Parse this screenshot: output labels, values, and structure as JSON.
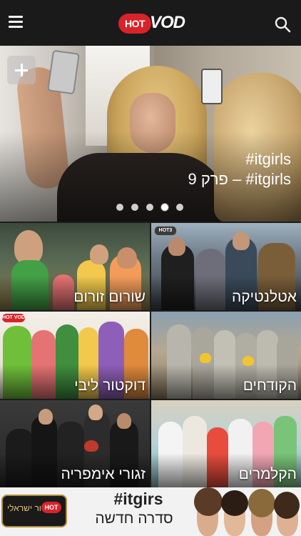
{
  "header": {
    "logo_hot": "HOT",
    "logo_vod": "VOD",
    "menu_icon": "hamburger-menu-icon",
    "search_icon": "search-icon"
  },
  "hero": {
    "line1": "itgirls#",
    "line2": "itgirls# – פרק 9",
    "add_icon": "plus-icon",
    "carousel": {
      "count": 5,
      "active_index": 3
    }
  },
  "tiles": [
    {
      "title": "שורום זורום",
      "badge": ""
    },
    {
      "title": "אטלנטיקה",
      "badge": "HOT3"
    },
    {
      "title": "דוקטור ליבי",
      "badge": "HOT VOD"
    },
    {
      "title": "הקודחים",
      "badge": ""
    },
    {
      "title": "זגורי אימפריה",
      "badge": ""
    },
    {
      "title": "הקלמרים",
      "badge": ""
    }
  ],
  "banner": {
    "brand_hot": "HOT",
    "brand_text": "בידור ישראלי",
    "hashtag": "#itgirs",
    "subtitle": "סדרה חדשה"
  },
  "colors": {
    "accent_red": "#d8232a",
    "topbar": "#1a1a1a",
    "banner_bg": "#f2f2f2"
  }
}
